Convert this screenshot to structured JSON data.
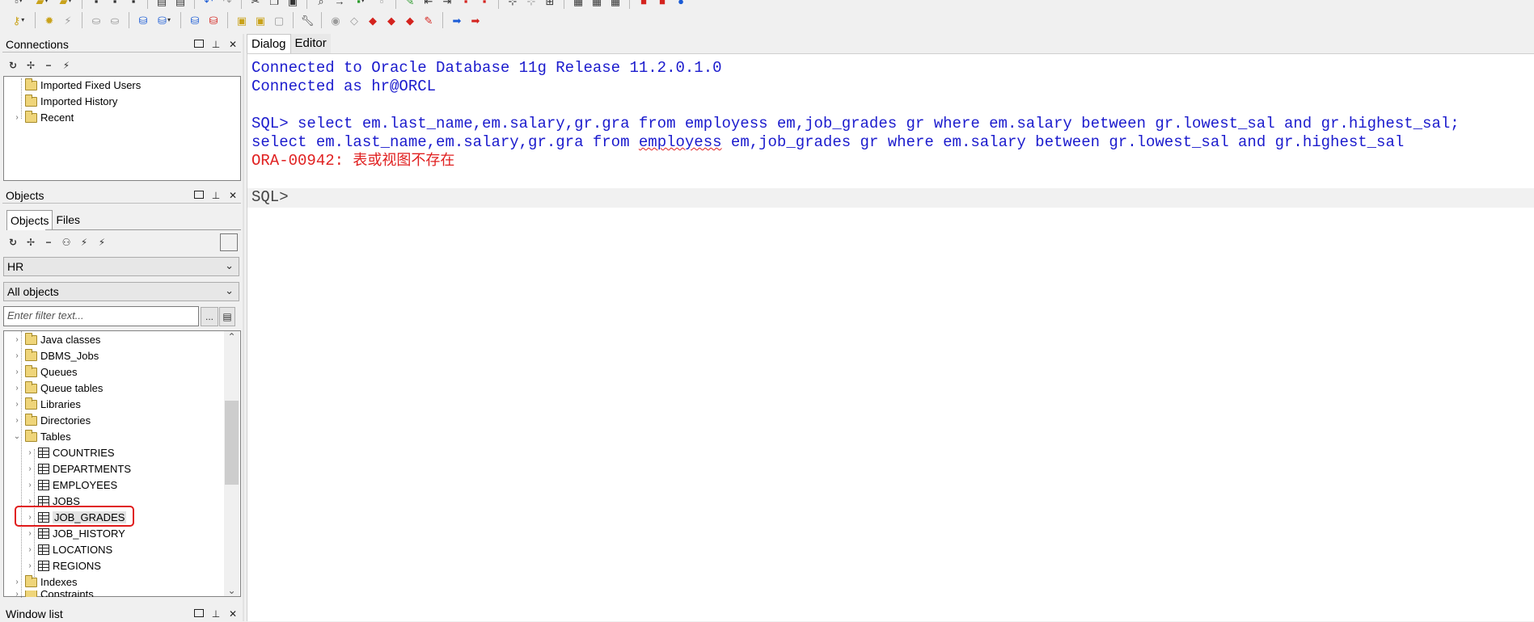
{
  "toolbar": {
    "row1_icons": [
      "new-icon",
      "open-icon",
      "save-icon",
      "print-icon",
      "undo-icon",
      "redo-icon",
      "cut-icon",
      "copy-icon",
      "paste-icon",
      "find-icon",
      "replace-icon",
      "window-icon",
      "layout-icon",
      "export-icon",
      "help-icon"
    ],
    "row2_icons": [
      "key-icon",
      "settings-icon",
      "run-icon",
      "stop-icon",
      "database-icon",
      "sql-icon",
      "connect-icon",
      "commit-icon",
      "rollback-icon",
      "debug-icon",
      "wrench-icon",
      "bug-icon",
      "back-arrow-icon",
      "forward-arrow-icon"
    ]
  },
  "connections": {
    "title": "Connections",
    "items": [
      {
        "label": "Imported Fixed Users"
      },
      {
        "label": "Imported History"
      },
      {
        "label": "Recent"
      }
    ]
  },
  "objects": {
    "title": "Objects",
    "tabs": [
      "Objects",
      "Files"
    ],
    "schema_select": "HR",
    "type_select": "All objects",
    "filter_placeholder": "Enter filter text...",
    "filter_button": "...",
    "tree": [
      {
        "label": "Java classes"
      },
      {
        "label": "DBMS_Jobs"
      },
      {
        "label": "Queues"
      },
      {
        "label": "Queue tables"
      },
      {
        "label": "Libraries"
      },
      {
        "label": "Directories"
      },
      {
        "label": "Tables"
      },
      {
        "label": "COUNTRIES"
      },
      {
        "label": "DEPARTMENTS"
      },
      {
        "label": "EMPLOYEES"
      },
      {
        "label": "JOBS"
      },
      {
        "label": "JOB_GRADES"
      },
      {
        "label": "JOB_HISTORY"
      },
      {
        "label": "LOCATIONS"
      },
      {
        "label": "REGIONS"
      },
      {
        "label": "Indexes"
      },
      {
        "label": "Constraints"
      }
    ]
  },
  "window_list": {
    "title": "Window list"
  },
  "main": {
    "tabs": [
      "Dialog",
      "Editor"
    ],
    "lines": {
      "connected1": "Connected to Oracle Database 11g Release 11.2.0.1.0",
      "connected2": "Connected as hr@ORCL",
      "sql_cmd": "SQL> select em.last_name,em.salary,gr.gra from employess em,job_grades gr where em.salary between gr.lowest_sal and gr.highest_sal;",
      "echo_a": "select em.last_name,em.salary,gr.gra from ",
      "echo_b": "employess",
      "echo_c": " em,job_grades gr where em.salary between gr.lowest_sal and gr.highest_sal",
      "error_code": "ORA-00942: ",
      "error_msg": "表或视图不存在",
      "prompt": "SQL>"
    }
  },
  "colors": {
    "output_blue": "#1b1bcd",
    "error_red": "#e02020",
    "highlight_red": "#e01b1b"
  }
}
